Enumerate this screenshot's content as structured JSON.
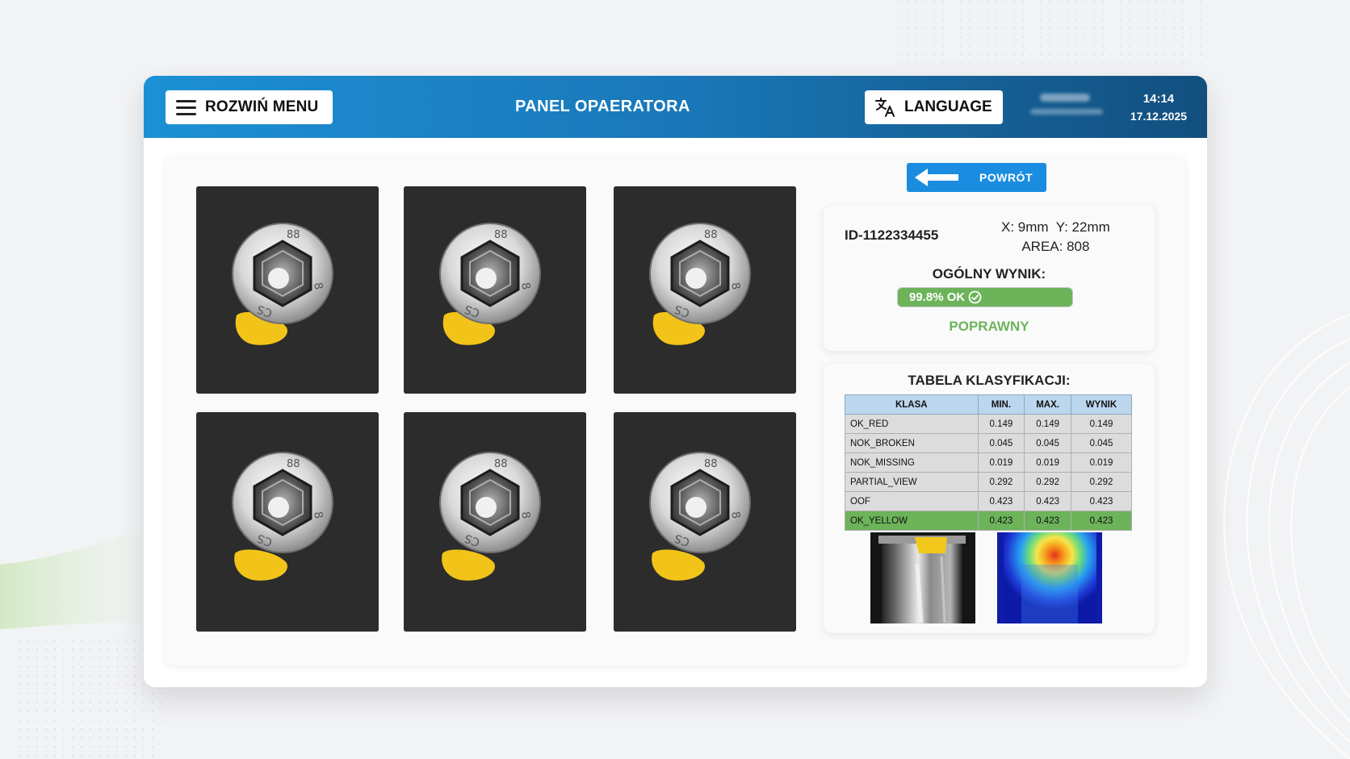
{
  "header": {
    "menu_label": "ROZWIŃ MENU",
    "title": "PANEL OPAERATORA",
    "language_label": "LANGUAGE",
    "time": "14:14",
    "date": "17.12.2025"
  },
  "back_button": {
    "label": "POWRÓT"
  },
  "result": {
    "id": "ID-1122334455",
    "coords_line1": "X: 9mm  Y: 22mm",
    "coords_line2": "AREA: 808",
    "overall_label": "OGÓLNY WYNIK:",
    "progress_text": "99.8% OK",
    "progress_value": 0.998,
    "verdict": "POPRAWNY"
  },
  "classification": {
    "title": "TABELA KLASYFIKACJI:",
    "headers": [
      "KLASA",
      "MIN.",
      "MAX.",
      "WYNIK"
    ],
    "rows": [
      [
        "OK_RED",
        "0.149",
        "0.149",
        "0.149"
      ],
      [
        "NOK_BROKEN",
        "0.045",
        "0.045",
        "0.045"
      ],
      [
        "NOK_MISSING",
        "0.019",
        "0.019",
        "0.019"
      ],
      [
        "PARTIAL_VIEW",
        "0.292",
        "0.292",
        "0.292"
      ],
      [
        "OOF",
        "0.423",
        "0.423",
        "0.423"
      ],
      [
        "OK_YELLOW",
        "0.423",
        "0.423",
        "0.423"
      ]
    ],
    "highlighted_row": 5
  },
  "colors": {
    "header_start": "#1c90d4",
    "header_end": "#124f7e",
    "ok_green": "#6cb35a",
    "back_button": "#1a8de0",
    "table_header": "#bcd6ee"
  },
  "icons": {
    "menu": "hamburger-icon",
    "language": "translate-icon",
    "back": "arrow-left-icon",
    "ok": "check-circle-icon"
  }
}
